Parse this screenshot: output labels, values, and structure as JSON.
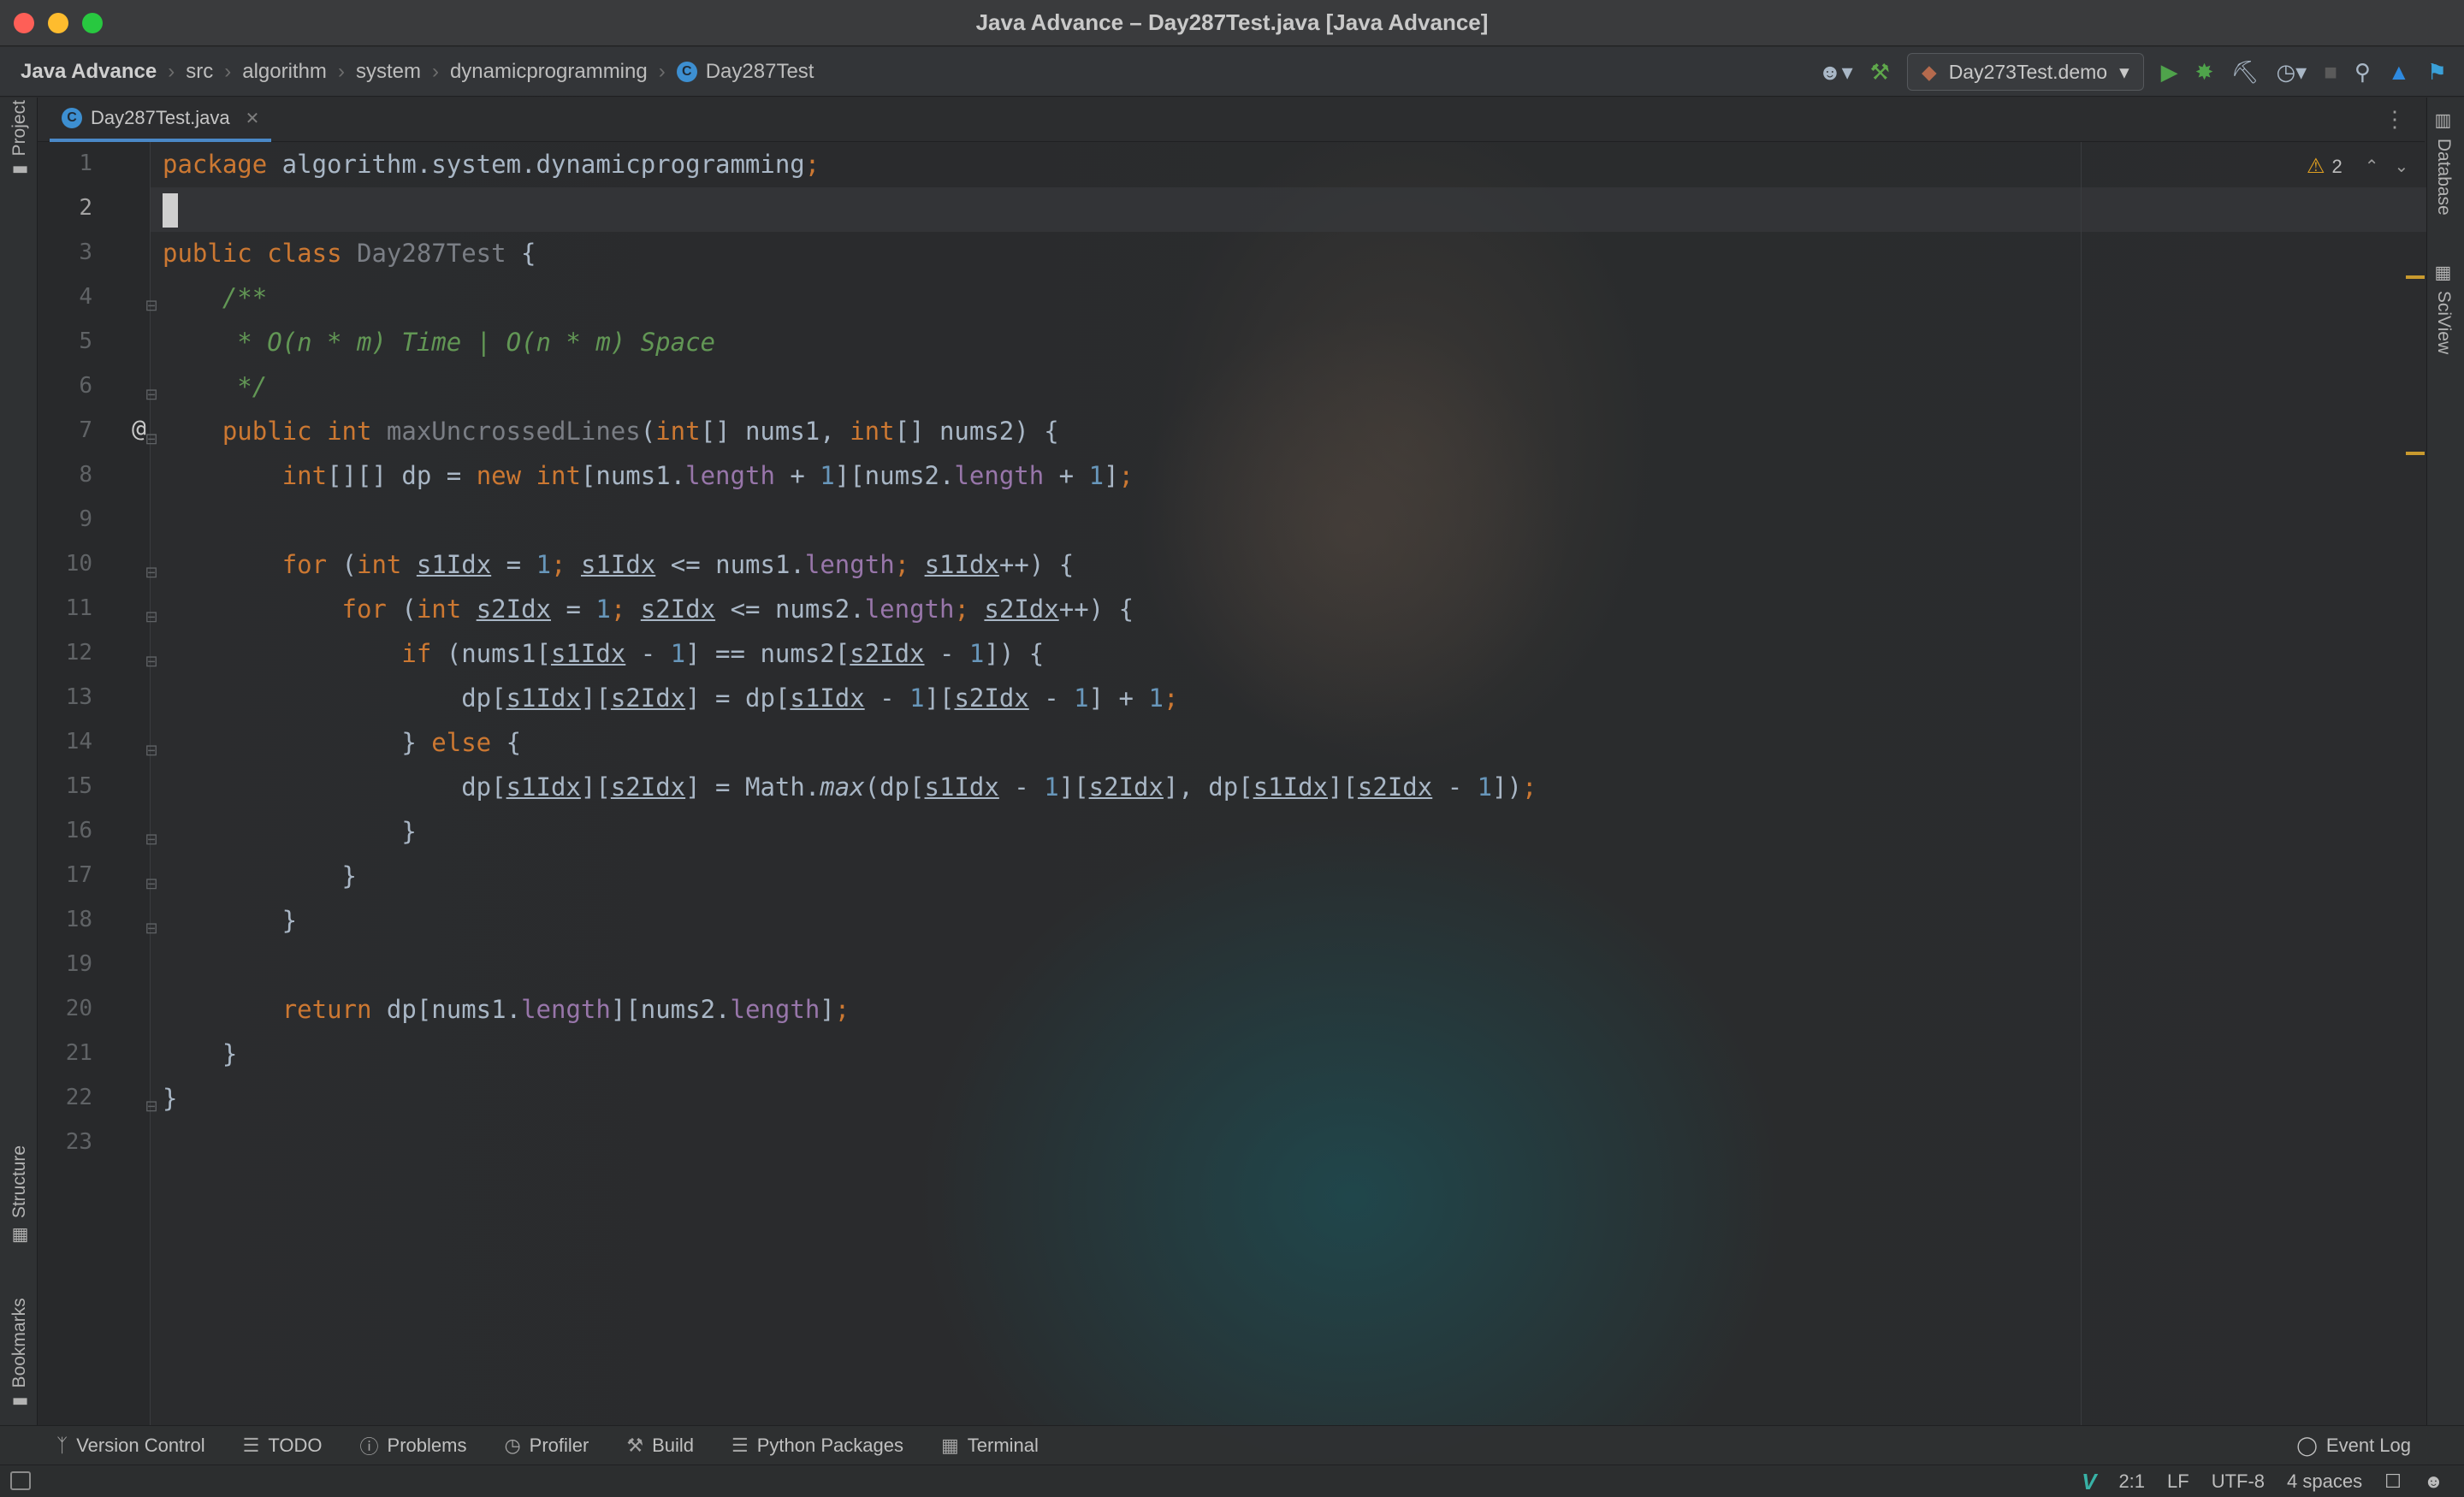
{
  "window": {
    "title": "Java Advance – Day287Test.java [Java Advance]"
  },
  "breadcrumbs": [
    "Java Advance",
    "src",
    "algorithm",
    "system",
    "dynamicprogramming",
    "Day287Test"
  ],
  "toolbar": {
    "run_config": "Day273Test.demo",
    "icons": [
      "account-icon",
      "build-hammer-icon",
      "run-icon",
      "debug-icon",
      "coverage-icon",
      "profile-icon",
      "stop-icon",
      "search-icon",
      "update-icon",
      "plugin-icon"
    ]
  },
  "editor_tab": {
    "label": "Day287Test.java"
  },
  "left_tools": {
    "project": "Project",
    "structure": "Structure",
    "bookmarks": "Bookmarks"
  },
  "right_tools": {
    "database": "Database",
    "sciview": "SciView"
  },
  "inspections": {
    "warnings": "2"
  },
  "line_numbers": [
    "1",
    "2",
    "3",
    "4",
    "5",
    "6",
    "7",
    "8",
    "9",
    "10",
    "11",
    "12",
    "13",
    "14",
    "15",
    "16",
    "17",
    "18",
    "19",
    "20",
    "21",
    "22",
    "23"
  ],
  "code": {
    "l1": {
      "kw": "package",
      "rest": " algorithm.system.dynamicprogramming",
      "semi": ";"
    },
    "l3": {
      "kw1": "public",
      "kw2": " class",
      "cls": " Day287Test",
      "rest": " {"
    },
    "l4": {
      "c": "    /**"
    },
    "l5": {
      "c": "     * O(n * m) Time | O(n * m) Space"
    },
    "l6": {
      "c": "     */"
    },
    "l7": {
      "ind": "    ",
      "kw1": "public",
      "kw2": " int",
      "fn": " maxUncrossedLines",
      "p1": "(",
      "t1": "int",
      "p2": "[] nums1, ",
      "t2": "int",
      "p3": "[] nums2) {"
    },
    "l8": {
      "ind": "        ",
      "t1": "int",
      "a": "[][] dp = ",
      "kw": "new",
      "t2": " int",
      "b": "[nums1.",
      "f1": "length",
      "c": " + ",
      "n1": "1",
      "d": "][nums2.",
      "f2": "length",
      "e": " + ",
      "n2": "1",
      "g": "]",
      "semi": ";"
    },
    "l10": {
      "ind": "        ",
      "kw": "for",
      "a": " (",
      "t": "int",
      "b": " ",
      "v1": "s1Idx",
      "c": " = ",
      "n": "1",
      "s1": ";",
      "d": " ",
      "v2": "s1Idx",
      "e": " <= nums1.",
      "f": "length",
      "s2": ";",
      "g": " ",
      "v3": "s1Idx",
      "h": "++) {"
    },
    "l11": {
      "ind": "            ",
      "kw": "for",
      "a": " (",
      "t": "int",
      "b": " ",
      "v1": "s2Idx",
      "c": " = ",
      "n": "1",
      "s1": ";",
      "d": " ",
      "v2": "s2Idx",
      "e": " <= nums2.",
      "f": "length",
      "s2": ";",
      "g": " ",
      "v3": "s2Idx",
      "h": "++) {"
    },
    "l12": {
      "ind": "                ",
      "kw": "if",
      "a": " (nums1[",
      "v1": "s1Idx",
      "b": " - ",
      "n1": "1",
      "c": "] == nums2[",
      "v2": "s2Idx",
      "d": " - ",
      "n2": "1",
      "e": "]) {"
    },
    "l13": {
      "ind": "                    ",
      "a": "dp[",
      "v1": "s1Idx",
      "b": "][",
      "v2": "s2Idx",
      "c": "] = dp[",
      "v3": "s1Idx",
      "d": " - ",
      "n1": "1",
      "e": "][",
      "v4": "s2Idx",
      "f": " - ",
      "n2": "1",
      "g": "] + ",
      "n3": "1",
      "semi": ";"
    },
    "l14": {
      "ind": "                ",
      "a": "} ",
      "kw": "else",
      "b": " {"
    },
    "l15": {
      "ind": "                    ",
      "a": "dp[",
      "v1": "s1Idx",
      "b": "][",
      "v2": "s2Idx",
      "c": "] = Math.",
      "m": "max",
      "d": "(dp[",
      "v3": "s1Idx",
      "e": " - ",
      "n1": "1",
      "f": "][",
      "v4": "s2Idx",
      "g": "], dp[",
      "v5": "s1Idx",
      "h": "][",
      "v6": "s2Idx",
      "i": " - ",
      "n2": "1",
      "j": "])",
      "semi": ";"
    },
    "l16": {
      "t": "                }"
    },
    "l17": {
      "t": "            }"
    },
    "l18": {
      "t": "        }"
    },
    "l20": {
      "ind": "        ",
      "kw": "return",
      "a": " dp[nums1.",
      "f1": "length",
      "b": "][nums2.",
      "f2": "length",
      "c": "]",
      "semi": ";"
    },
    "l21": {
      "t": "    }"
    },
    "l22": {
      "t": "}"
    }
  },
  "tool_windows": [
    "Version Control",
    "TODO",
    "Problems",
    "Profiler",
    "Build",
    "Python Packages",
    "Terminal"
  ],
  "event_log": "Event Log",
  "status": {
    "position": "2:1",
    "line_sep": "LF",
    "encoding": "UTF-8",
    "indent": "4 spaces"
  }
}
